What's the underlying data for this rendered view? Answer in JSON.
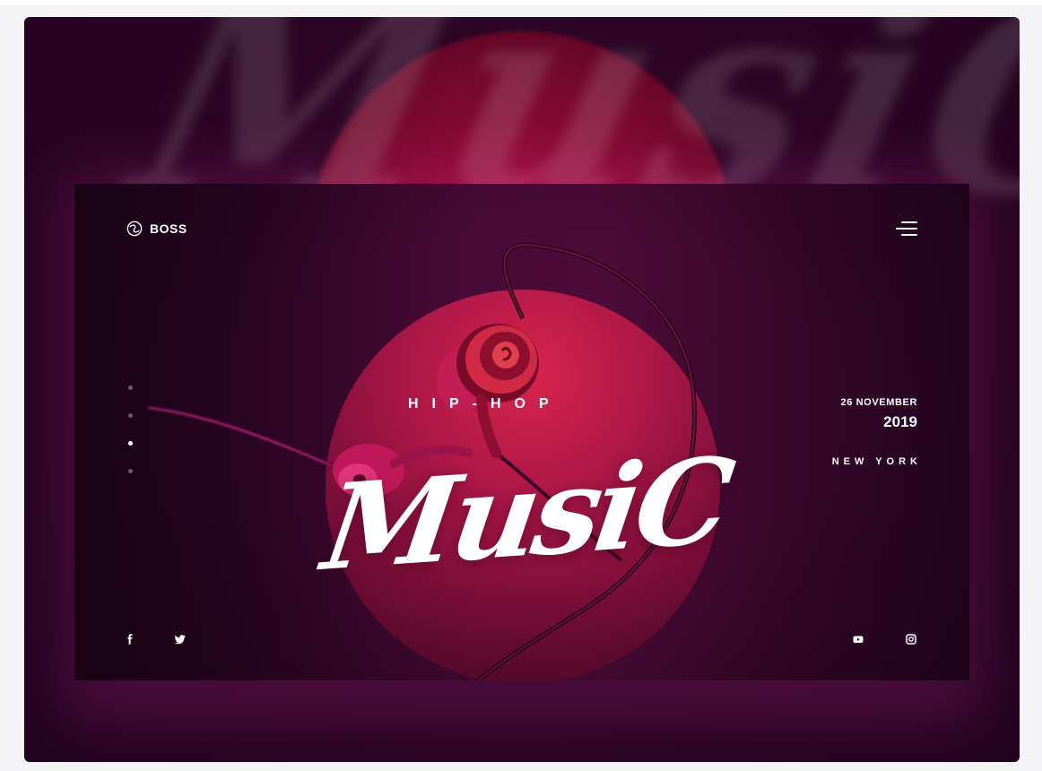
{
  "brand": {
    "name": "BOSS",
    "logo_icon": "swirl-logo-icon"
  },
  "header": {
    "menu_icon": "hamburger-menu-icon"
  },
  "background": {
    "blurred_word": "MusiC"
  },
  "hero": {
    "genre": "HIP-HOP",
    "title": "MusiC"
  },
  "event": {
    "date": "26 NOVEMBER",
    "year": "2019",
    "city": "NEW YORK"
  },
  "pager": {
    "count": 4,
    "active_index": 2
  },
  "social": {
    "left": [
      {
        "icon": "facebook-icon",
        "label": "f"
      },
      {
        "icon": "twitter-icon",
        "label": "twitter"
      }
    ],
    "right": [
      {
        "icon": "youtube-icon",
        "label": "youtube"
      },
      {
        "icon": "instagram-icon",
        "label": "instagram"
      }
    ]
  },
  "colors": {
    "frame_bg": "#2a0423",
    "accent_red": "#c2124a",
    "card_magenta": "#4a0a38",
    "text": "#ffffff"
  }
}
